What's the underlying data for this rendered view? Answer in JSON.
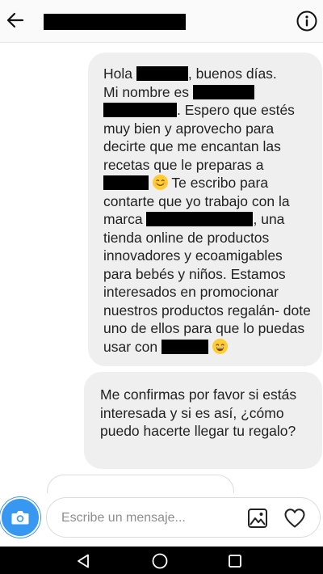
{
  "header": {
    "back_icon": "arrow-left-icon",
    "info_icon": "info-circle-icon"
  },
  "messages": [
    {
      "segments": [
        {
          "text": "Hola "
        },
        {
          "redacted": true
        },
        {
          "text": ", buenos días."
        },
        {
          "text": "Mi nombre es "
        },
        {
          "redacted": true
        },
        {
          "redacted": true
        },
        {
          "text": ". Espero que estés muy bien y aprovecho para decirte que me encantan las recetas que le preparas a "
        },
        {
          "redacted": true
        },
        {
          "emoji": "smiling-face-emoji"
        },
        {
          "text": " Te escribo para contarte que yo trabajo con la marca "
        },
        {
          "redacted": true
        },
        {
          "text": ", una tienda online de productos innovadores y ecoamigables para bebés y niños. Estamos interesados en promocionar nuestros productos regalán- dote uno de ellos para que lo puedas usar con "
        },
        {
          "redacted": true
        },
        {
          "emoji": "grinning-face-emoji"
        }
      ]
    },
    {
      "text": "Me confirmas por favor si estás interesada y si es así, ¿cómo puedo hacerte llegar tu regalo?"
    }
  ],
  "composer": {
    "placeholder": "Escribe un mensaje...",
    "camera_icon": "camera-icon",
    "gallery_icon": "image-icon",
    "like_icon": "heart-icon"
  },
  "system_nav": {
    "back_icon": "triangle-back-icon",
    "home_icon": "circle-home-icon",
    "recents_icon": "square-recents-icon"
  },
  "colors": {
    "accent": "#3897f0",
    "bubble": "#efefef",
    "redaction": "#000000",
    "emoji": "#ffcc33"
  }
}
